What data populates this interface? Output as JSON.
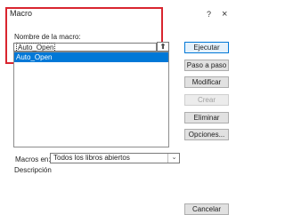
{
  "dialog": {
    "title": "Macro",
    "help": "?",
    "close": "×"
  },
  "name_section": {
    "label": "Nombre de la macro:",
    "value": "Auto_Open",
    "up_icon": "upload-arrow-icon",
    "up_glyph": "⇑"
  },
  "macro_list": {
    "items": [
      "Auto_Open"
    ],
    "selected_index": 0
  },
  "buttons": {
    "execute": "Ejecutar",
    "step_into": "Paso a paso",
    "modify": "Modificar",
    "create": "Crear",
    "delete": "Eliminar",
    "options": "Opciones...",
    "cancel": "Cancelar"
  },
  "macros_in": {
    "label": "Macros en:",
    "value": "Todos los libros abiertos",
    "arrow": "⌄"
  },
  "description": {
    "label": "Descripción"
  },
  "colors": {
    "highlight_border": "#d9252f",
    "selection": "#0078d7"
  }
}
